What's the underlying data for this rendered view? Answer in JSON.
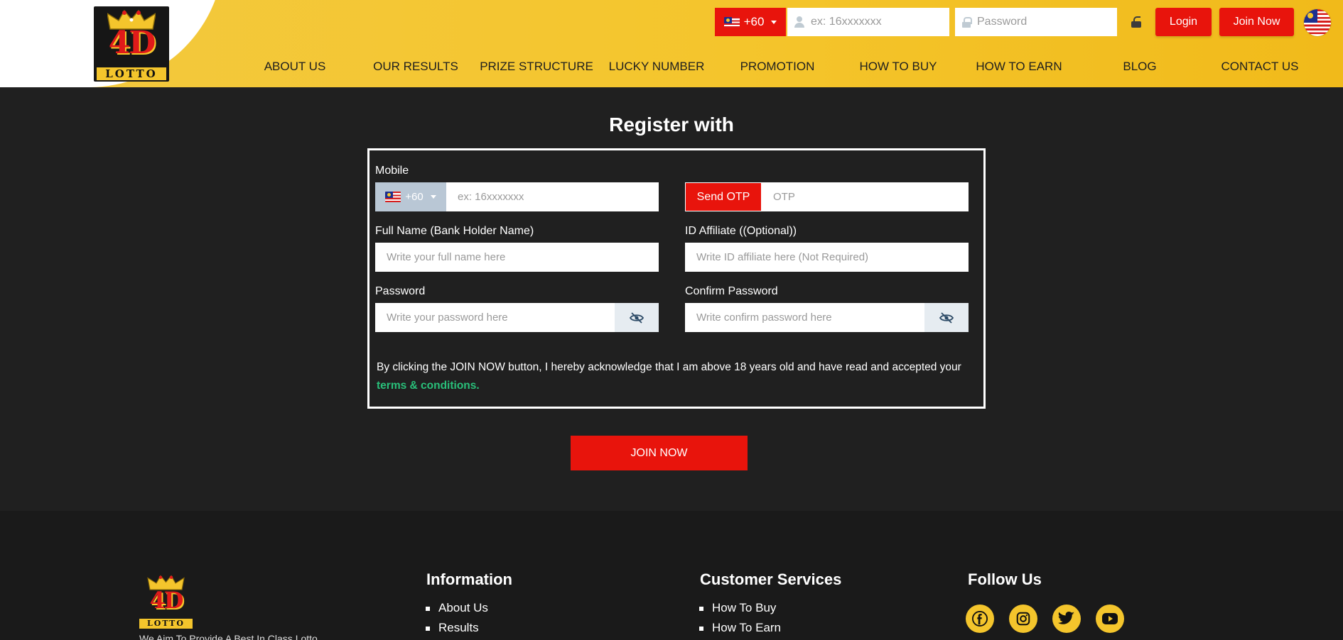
{
  "brand": {
    "logo_top": "4D",
    "logo_bottom": "LOTTO"
  },
  "top_bar": {
    "country_code": "+60",
    "mobile_placeholder": "ex: 16xxxxxxx",
    "password_placeholder": "Password",
    "login_label": "Login",
    "join_label": "Join Now"
  },
  "nav": [
    "ABOUT US",
    "OUR RESULTS",
    "PRIZE STRUCTURE",
    "LUCKY NUMBER",
    "PROMOTION",
    "HOW TO BUY",
    "HOW TO EARN",
    "BLOG",
    "CONTACT US"
  ],
  "register": {
    "title": "Register with",
    "mobile_label": "Mobile",
    "country_code": "+60",
    "mobile_placeholder": "ex: 16xxxxxxx",
    "send_otp_label": "Send OTP",
    "otp_placeholder": "OTP",
    "fullname_label": "Full Name (Bank Holder Name)",
    "fullname_placeholder": "Write your full name here",
    "affiliate_label": "ID Affiliate ((Optional))",
    "affiliate_placeholder": "Write ID affiliate here (Not Required)",
    "password_label": "Password",
    "password_placeholder": "Write your password here",
    "confirm_label": "Confirm Password",
    "confirm_placeholder": "Write confirm password here",
    "consent_text": "By clicking the JOIN NOW button, I hereby acknowledge that I am above 18 years old and have read and accepted your",
    "consent_link": "terms & conditions.",
    "join_button": "JOIN NOW"
  },
  "footer": {
    "tagline": "We Aim To Provide A Best In Class Lotto",
    "information_heading": "Information",
    "information_items": [
      "About Us",
      "Results"
    ],
    "customer_heading": "Customer Services",
    "customer_items": [
      "How To Buy",
      "How To Earn"
    ],
    "follow_heading": "Follow Us",
    "social_icons": [
      "facebook-icon",
      "instagram-icon",
      "twitter-icon",
      "youtube-icon"
    ]
  },
  "colors": {
    "header_gold": "#f4c52c",
    "accent_red": "#e8140c",
    "background_dark": "#202020",
    "link_green": "#29c07a"
  }
}
